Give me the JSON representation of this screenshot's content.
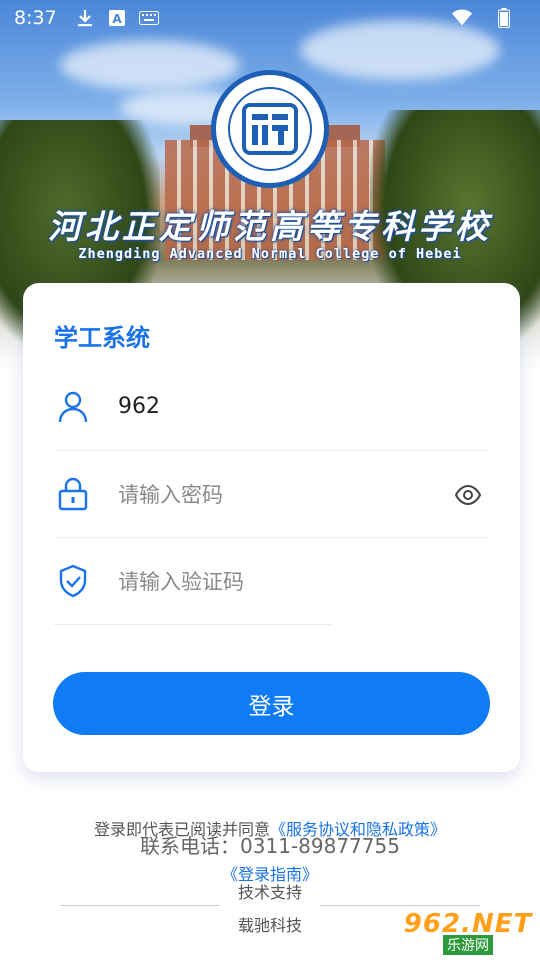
{
  "status_bar": {
    "time": "8:37",
    "icons": [
      "download-icon",
      "font-icon",
      "keyboard-icon"
    ],
    "right_icons": [
      "wifi-icon",
      "battery-icon"
    ]
  },
  "header": {
    "school_name_cn": "河北正定师范高等专科学校",
    "school_name_en": "Zhengding Advanced Normal College of Hebei",
    "logo_mark": "正师"
  },
  "card": {
    "title": "学工系统",
    "username": {
      "value": "962"
    },
    "password": {
      "placeholder": "请输入密码"
    },
    "captcha": {
      "placeholder": "请输入验证码"
    },
    "login_label": "登录"
  },
  "footer": {
    "agree_prefix": "登录即代表已阅读并同意",
    "agree_link": "《服务协议和隐私政策》",
    "phone": "联系电话：0311-89877755",
    "guide": "《登录指南》",
    "tech_label": "技术支持",
    "company": "载驰科技"
  },
  "watermark": {
    "main": "962.NET",
    "sub": "乐游网"
  },
  "colors": {
    "accent": "#1a73e8",
    "button": "#0f7bf4",
    "logo_blue": "#1e5fb6"
  }
}
